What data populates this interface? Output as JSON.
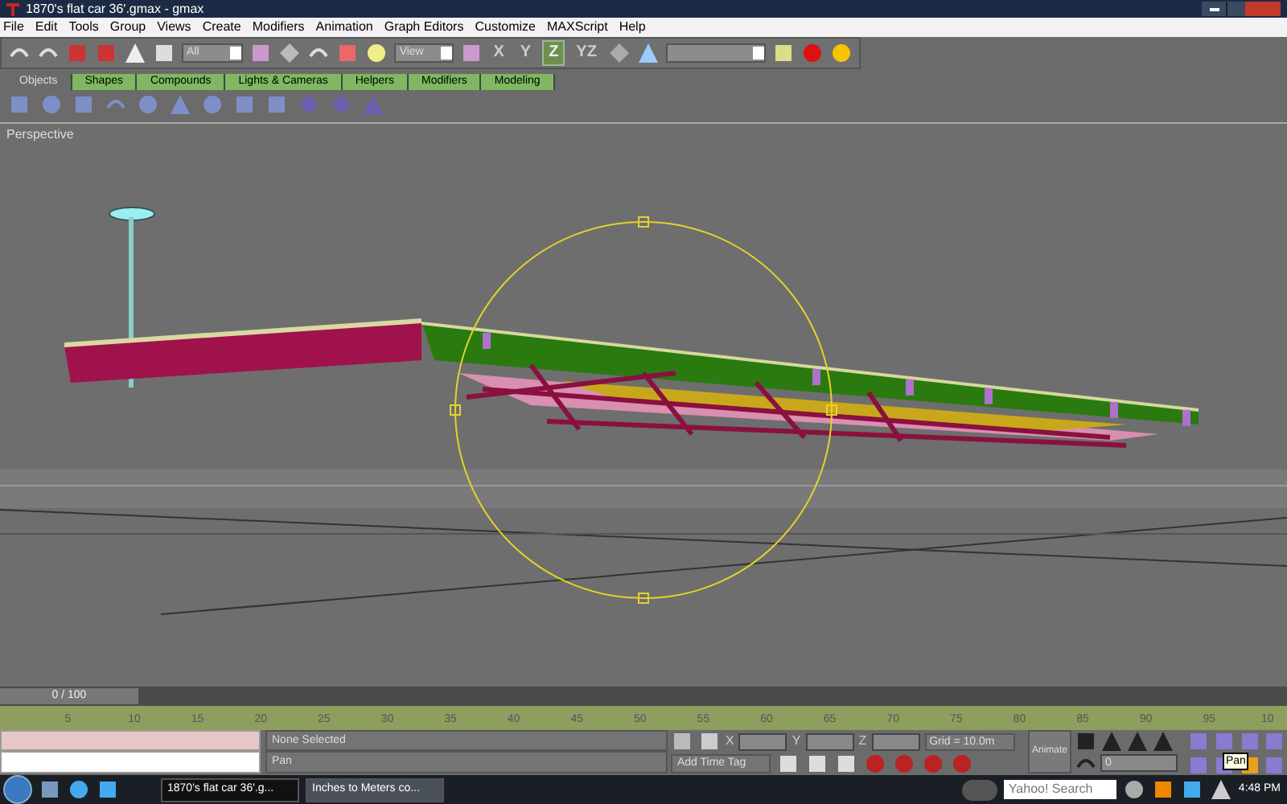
{
  "window": {
    "title": "1870's flat car 36'.gmax - gmax"
  },
  "menu": [
    "File",
    "Edit",
    "Tools",
    "Group",
    "Views",
    "Create",
    "Modifiers",
    "Animation",
    "Graph Editors",
    "Customize",
    "MAXScript",
    "Help"
  ],
  "toolbar": {
    "selection_filter": "All",
    "reference_coord": "View"
  },
  "axis_buttons": [
    {
      "label": "X",
      "selected": false
    },
    {
      "label": "Y",
      "selected": false
    },
    {
      "label": "Z",
      "selected": true
    },
    {
      "label": "YZ",
      "selected": false
    }
  ],
  "create_tabs": [
    {
      "label": "Objects",
      "selected": true
    },
    {
      "label": "Shapes",
      "selected": false
    },
    {
      "label": "Compounds",
      "selected": false
    },
    {
      "label": "Lights & Cameras",
      "selected": false
    },
    {
      "label": "Helpers",
      "selected": false
    },
    {
      "label": "Modifiers",
      "selected": false
    },
    {
      "label": "Modeling",
      "selected": false
    }
  ],
  "viewport": {
    "label": "Perspective"
  },
  "time_slider": {
    "frame": "0 / 100",
    "level": 0
  },
  "track_bar": {
    "ticks": [
      "5",
      "10",
      "15",
      "20",
      "25",
      "30",
      "35",
      "40",
      "45",
      "50",
      "55",
      "60",
      "65",
      "70",
      "75",
      "80",
      "85",
      "90",
      "95",
      "10"
    ]
  },
  "status": {
    "selection": "None Selected",
    "prompt": "Pan",
    "x_label": "X",
    "y_label": "Y",
    "z_label": "Z",
    "grid": "Grid = 10.0m",
    "time_tag": "Add Time Tag",
    "animate": "Animate",
    "frame": "0"
  },
  "tooltip": "Pan",
  "taskbar": {
    "items": [
      {
        "label": "1870's flat car 36'.g...",
        "selected": true
      },
      {
        "label": "Inches to Meters co...",
        "selected": false
      }
    ],
    "search_placeholder": "Yahoo! Search",
    "clock": "4:48 PM"
  }
}
